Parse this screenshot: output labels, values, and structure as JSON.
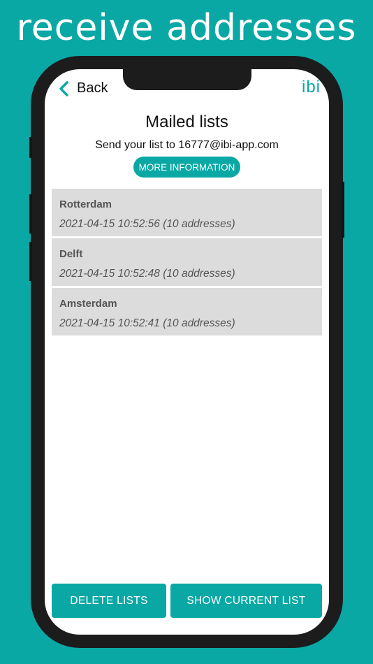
{
  "headline": "receive addresses",
  "colors": {
    "accent": "#0aa8a4",
    "item_bg": "#dcdcdc",
    "phone_frame": "#1c1c1c"
  },
  "nav": {
    "back_label": "Back",
    "back_icon": "chevron-left-icon",
    "brand": "ibi"
  },
  "page": {
    "title": "Mailed lists",
    "send_text": "Send your list to 16777@ibi-app.com",
    "info_button": "MORE INFORMATION"
  },
  "lists": [
    {
      "name": "Rotterdam",
      "meta": "2021-04-15 10:52:56 (10 addresses)"
    },
    {
      "name": "Delft",
      "meta": "2021-04-15 10:52:48 (10 addresses)"
    },
    {
      "name": "Amsterdam",
      "meta": "2021-04-15 10:52:41 (10 addresses)"
    }
  ],
  "actions": {
    "delete": "DELETE LISTS",
    "show_current": "SHOW CURRENT LIST"
  }
}
